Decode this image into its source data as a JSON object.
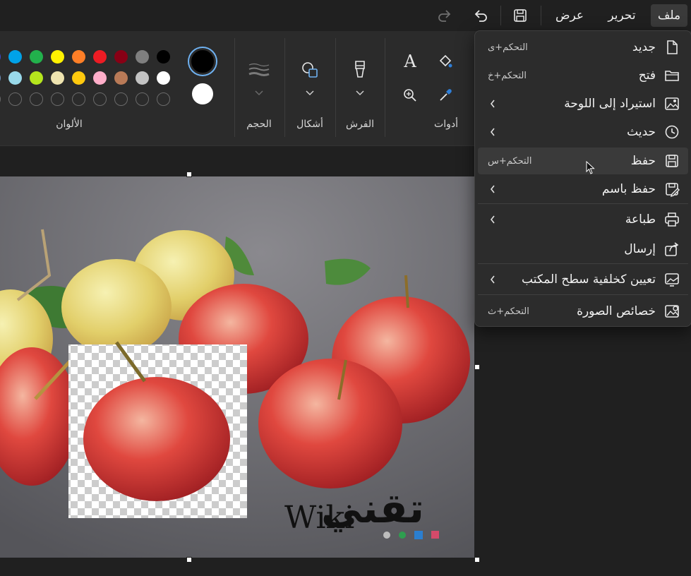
{
  "menubar": {
    "file": "ملف",
    "edit": "تحرير",
    "view": "عرض"
  },
  "ribbon": {
    "tools_label": "أدوات",
    "brushes_label": "الفرش",
    "shapes_label": "أشكال",
    "size_label": "الحجم",
    "colors_label": "الألوان",
    "text_tool_glyph": "A",
    "colors_row1": [
      "#000000",
      "#7f7f7f",
      "#880015",
      "#ed1c24",
      "#ff7f27",
      "#fff200",
      "#22b14c",
      "#00a2e8",
      "#3f48cc"
    ],
    "colors_row2": [
      "#ffffff",
      "#c3c3c3",
      "#b97a57",
      "#ffaec9",
      "#ffc90e",
      "#efe4b0",
      "#b5e61d",
      "#99d9ea",
      "#7092be"
    ],
    "primary_color": "#000000",
    "secondary_color": "#ffffff"
  },
  "file_menu": {
    "items": [
      {
        "label": "جديد",
        "shortcut": "التحكم+ى",
        "icon": "new-file-icon",
        "submenu": false
      },
      {
        "label": "فتح",
        "shortcut": "التحكم+خ",
        "icon": "open-folder-icon",
        "submenu": false
      },
      {
        "label": "استيراد إلى اللوحة",
        "shortcut": "",
        "icon": "import-image-icon",
        "submenu": true
      },
      {
        "label": "حديث",
        "shortcut": "",
        "icon": "recent-clock-icon",
        "submenu": true
      },
      {
        "label": "حفظ",
        "shortcut": "التحكم+س",
        "icon": "save-icon",
        "submenu": false
      },
      {
        "label": "حفظ باسم",
        "shortcut": "",
        "icon": "save-as-icon",
        "submenu": true
      },
      {
        "label": "طباعة",
        "shortcut": "",
        "icon": "print-icon",
        "submenu": true
      },
      {
        "label": "إرسال",
        "shortcut": "",
        "icon": "share-icon",
        "submenu": false
      },
      {
        "label": "تعيين كخلفية سطح المكتب",
        "shortcut": "",
        "icon": "desktop-background-icon",
        "submenu": true
      },
      {
        "label": "خصائص الصورة",
        "shortcut": "التحكم+ث",
        "icon": "image-properties-icon",
        "submenu": false
      }
    ]
  },
  "watermark": {
    "text_latin": "Wiki",
    "text_arabic": "تقني"
  }
}
